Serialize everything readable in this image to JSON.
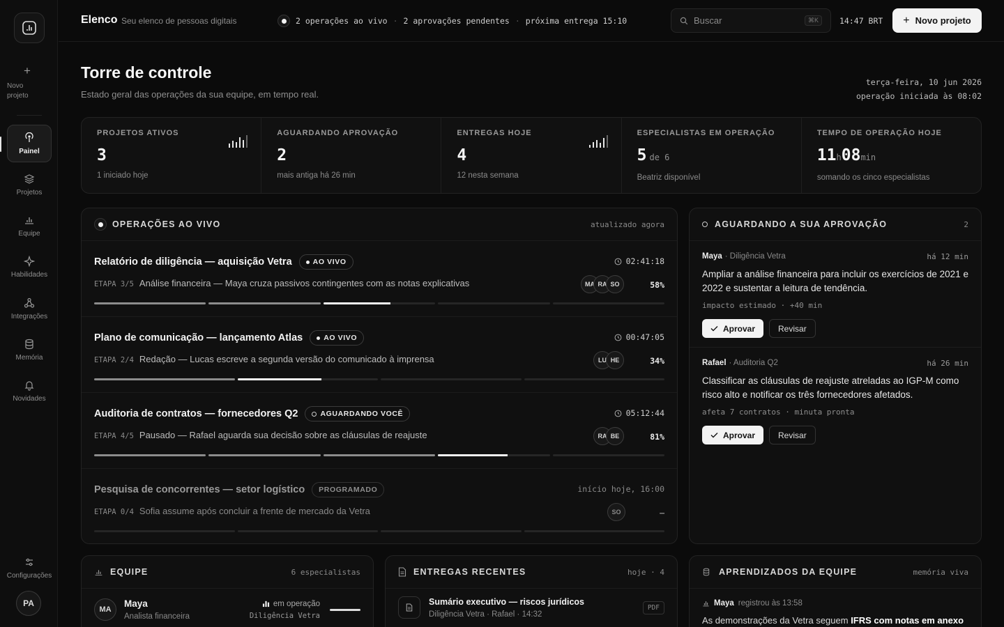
{
  "sidebar": {
    "new_project_label": "Novo projeto",
    "items": [
      {
        "label": "Painel",
        "icon": "broadcast-icon"
      },
      {
        "label": "Projetos",
        "icon": "layers-icon"
      },
      {
        "label": "Equipe",
        "icon": "bar-chart-icon"
      },
      {
        "label": "Habilidades",
        "icon": "sparkle-icon"
      },
      {
        "label": "Integrações",
        "icon": "nodes-icon"
      },
      {
        "label": "Memória",
        "icon": "database-icon"
      },
      {
        "label": "Novidades",
        "icon": "bell-icon"
      }
    ],
    "settings_label": "Configurações",
    "avatar_initials": "PA"
  },
  "topbar": {
    "brand": "Elenco",
    "brand_sub": "Seu elenco de pessoas digitais",
    "ticker": [
      "2 operações ao vivo",
      "2 aprovações pendentes",
      "próxima entrega 15:10"
    ],
    "search_placeholder": "Buscar",
    "shortcut": "⌘K",
    "clock": "14:47 BRT",
    "new_project_button": "Novo projeto"
  },
  "header": {
    "title": "Torre de controle",
    "subtitle": "Estado geral das operações da sua equipe, em tempo real.",
    "date": "terça-feira, 10 jun 2026",
    "started": "operação iniciada às 08:02"
  },
  "stats": [
    {
      "label": "PROJETOS ATIVOS",
      "value": "3",
      "note": "1 iniciado hoje",
      "spark": [
        5,
        9,
        7,
        13,
        10,
        16
      ]
    },
    {
      "label": "AGUARDANDO APROVAÇÃO",
      "value": "2",
      "note": "mais antiga há 26 min"
    },
    {
      "label": "ENTREGAS HOJE",
      "value": "4",
      "note": "12 nesta semana",
      "spark": [
        4,
        8,
        11,
        7,
        14,
        18
      ]
    },
    {
      "label": "ESPECIALISTAS EM OPERAÇÃO",
      "value": "5",
      "suffix": "de 6",
      "note": "Beatriz disponível"
    },
    {
      "label": "TEMPO DE OPERAÇÃO HOJE",
      "value_h": "11",
      "unit_h": "h",
      "value_m": "08",
      "unit_m": "min",
      "note": "somando os cinco especialistas"
    }
  ],
  "operations": {
    "title": "OPERAÇÕES AO VIVO",
    "updated": "atualizado agora",
    "items": [
      {
        "name": "Relatório de diligência — aquisição Vetra",
        "badge": "AO VIVO",
        "time": "02:41:18",
        "stage_key": "ETAPA 3/5",
        "stage": "Análise financeira — Maya cruza passivos contingentes com as notas explicativas",
        "avatars": [
          "MA",
          "RA",
          "SO"
        ],
        "pct": "58%",
        "progress": [
          1,
          1,
          0.6,
          0,
          0
        ]
      },
      {
        "name": "Plano de comunicação — lançamento Atlas",
        "badge": "AO VIVO",
        "time": "00:47:05",
        "stage_key": "ETAPA 2/4",
        "stage": "Redação — Lucas escreve a segunda versão do comunicado à imprensa",
        "avatars": [
          "LU",
          "HE"
        ],
        "pct": "34%",
        "progress": [
          1,
          0.6,
          0,
          0
        ]
      },
      {
        "name": "Auditoria de contratos — fornecedores Q2",
        "badge": "AGUARDANDO VOCÊ",
        "time": "05:12:44",
        "stage_key": "ETAPA 4/5",
        "stage": "Pausado — Rafael aguarda sua decisão sobre as cláusulas de reajuste",
        "avatars": [
          "RA",
          "BE"
        ],
        "pct": "81%",
        "progress": [
          1,
          1,
          1,
          0.62,
          0
        ]
      },
      {
        "name": "Pesquisa de concorrentes — setor logístico",
        "badge": "PROGRAMADO",
        "time": "início hoje, 16:00",
        "stage_key": "ETAPA 0/4",
        "stage": "Sofia assume após concluir a frente de mercado da Vetra",
        "avatars": [
          "SO"
        ],
        "pct": "–",
        "progress": [
          0,
          0,
          0,
          0
        ]
      }
    ]
  },
  "approvals": {
    "title": "AGUARDANDO A SUA APROVAÇÃO",
    "count": "2",
    "items": [
      {
        "who": "Maya",
        "context": "· Diligência Vetra",
        "ago": "há 12 min",
        "text": "Ampliar a análise financeira para incluir os exercícios de 2021 e 2022 e sustentar a leitura de tendência.",
        "impact": "impacto estimado · +40 min",
        "approve": "Aprovar",
        "review": "Revisar"
      },
      {
        "who": "Rafael",
        "context": "· Auditoria Q2",
        "ago": "há 26 min",
        "text": "Classificar as cláusulas de reajuste atreladas ao IGP-M como risco alto e notificar os três fornecedores afetados.",
        "impact": "afeta 7 contratos · minuta pronta",
        "approve": "Aprovar",
        "review": "Revisar"
      }
    ]
  },
  "team": {
    "title": "EQUIPE",
    "meta": "6 especialistas",
    "first": {
      "initials": "MA",
      "name": "Maya",
      "role": "Analista financeira",
      "status": "em operação",
      "project": "Diligência Vetra"
    }
  },
  "deliveries": {
    "title": "ENTREGAS RECENTES",
    "meta": "hoje · 4",
    "first": {
      "title": "Sumário executivo — riscos jurídicos",
      "sub": "Diligência Vetra · Rafael · 14:32",
      "format": "PDF"
    }
  },
  "learnings": {
    "title": "APRENDIZADOS DA EQUIPE",
    "meta": "memória viva",
    "first": {
      "who": "Maya",
      "when": "registrou às 13:58",
      "text_a": "As demonstrações da Vetra seguem ",
      "text_b": "IFRS com notas em anexo"
    }
  }
}
